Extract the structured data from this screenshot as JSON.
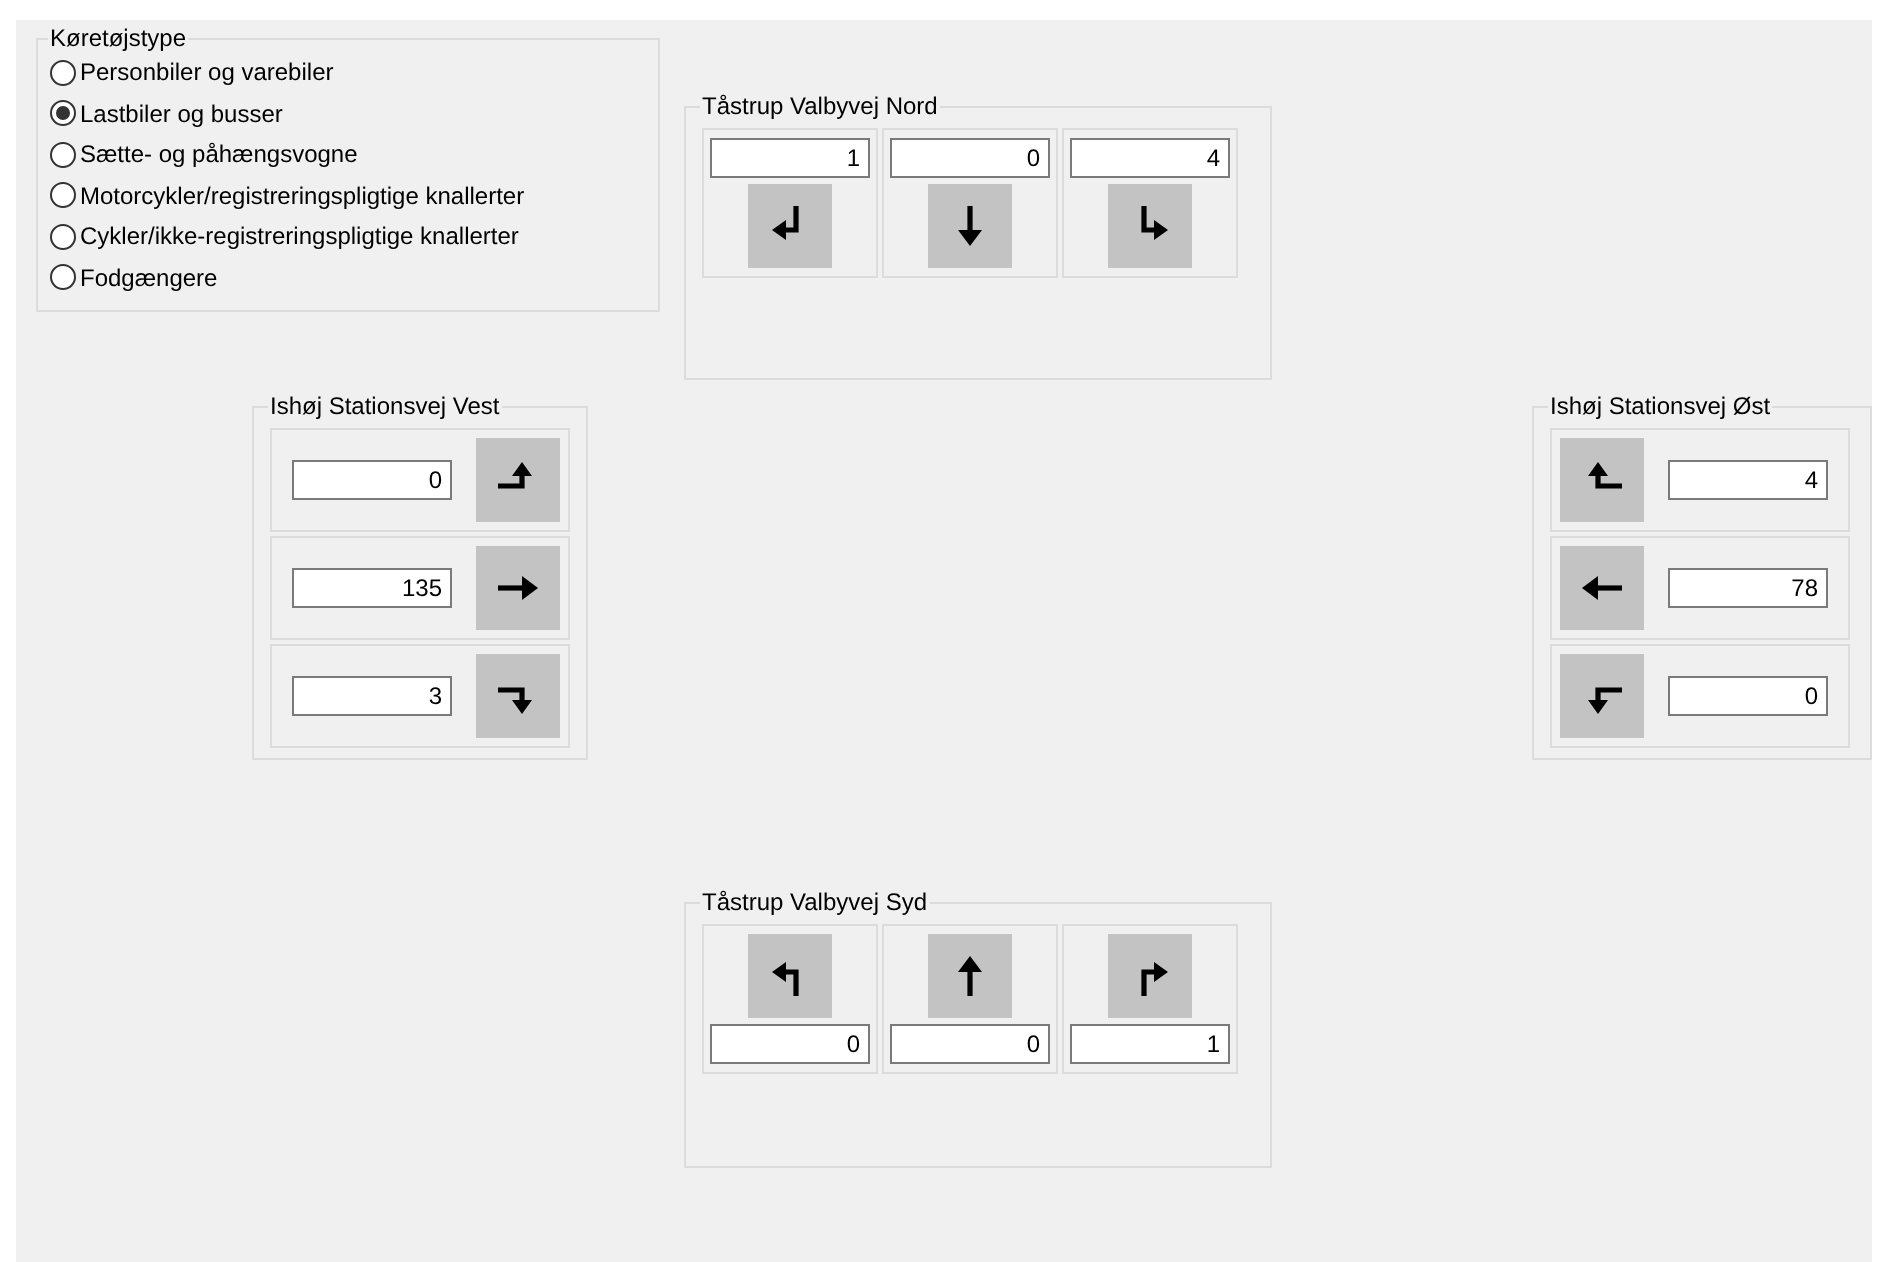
{
  "vehicle_type": {
    "title": "Køretøjstype",
    "options": [
      {
        "label": "Personbiler og varebiler",
        "selected": false
      },
      {
        "label": "Lastbiler og busser",
        "selected": true
      },
      {
        "label": "Sætte- og påhængsvogne",
        "selected": false
      },
      {
        "label": "Motorcykler/registreringspligtige knallerter",
        "selected": false
      },
      {
        "label": "Cykler/ikke-registreringspligtige knallerter",
        "selected": false
      },
      {
        "label": "Fodgængere",
        "selected": false
      }
    ]
  },
  "approaches": [
    {
      "title": "Tåstrup Valbyvej Nord",
      "kind": "north",
      "movements": [
        {
          "kind": "right",
          "count": "1"
        },
        {
          "kind": "straight",
          "count": "0"
        },
        {
          "kind": "left",
          "count": "4"
        }
      ]
    },
    {
      "title": "Ishøj Stationsvej Vest",
      "kind": "west",
      "movements": [
        {
          "kind": "left",
          "count": "0"
        },
        {
          "kind": "straight",
          "count": "135"
        },
        {
          "kind": "right",
          "count": "3"
        }
      ]
    },
    {
      "title": "Ishøj Stationsvej Øst",
      "kind": "east",
      "movements": [
        {
          "kind": "right",
          "count": "4"
        },
        {
          "kind": "straight",
          "count": "78"
        },
        {
          "kind": "left",
          "count": "0"
        }
      ]
    },
    {
      "title": "Tåstrup Valbyvej Syd",
      "kind": "south",
      "movements": [
        {
          "kind": "left",
          "count": "0"
        },
        {
          "kind": "straight",
          "count": "0"
        },
        {
          "kind": "right",
          "count": "1"
        }
      ]
    }
  ]
}
